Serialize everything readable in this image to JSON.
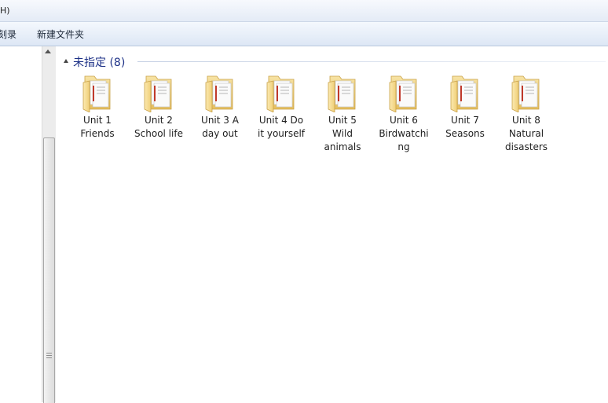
{
  "menubar": {
    "partial_text": "H)"
  },
  "toolbar": {
    "left_partial": "刻录",
    "new_folder": "新建文件夹"
  },
  "group": {
    "title": "未指定 (8)"
  },
  "items": [
    {
      "label": "Unit 1\nFriends"
    },
    {
      "label": "Unit 2\nSchool life"
    },
    {
      "label": "Unit 3 A\nday out"
    },
    {
      "label": "Unit 4 Do\nit yourself"
    },
    {
      "label": "Unit 5\nWild\nanimals"
    },
    {
      "label": "Unit 6\nBirdwatchi\nng"
    },
    {
      "label": "Unit 7\nSeasons"
    },
    {
      "label": "Unit 8\nNatural\ndisasters"
    }
  ],
  "colors": {
    "folder": "#f2d27e",
    "group_title": "#1e3287",
    "toolbar": "#dde7f5"
  }
}
